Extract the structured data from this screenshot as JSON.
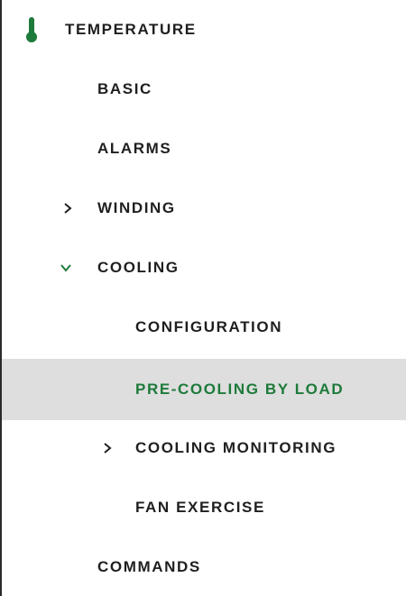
{
  "nav": {
    "root": {
      "label": "TEMPERATURE",
      "icon": "thermometer-icon",
      "icon_color": "#1d7a3a"
    },
    "items": [
      {
        "label": "BASIC"
      },
      {
        "label": "ALARMS"
      },
      {
        "label": "WINDING",
        "state": "collapsed"
      },
      {
        "label": "COOLING",
        "state": "expanded"
      },
      {
        "label": "CONFIGURATION"
      },
      {
        "label": "PRE-COOLING BY LOAD",
        "selected": true
      },
      {
        "label": "COOLING MONITORING",
        "state": "collapsed"
      },
      {
        "label": "FAN EXERCISE"
      },
      {
        "label": "COMMANDS"
      }
    ]
  },
  "colors": {
    "accent": "#1d7a3a",
    "selected_background": "#dedede",
    "text": "#1f1f1f"
  }
}
